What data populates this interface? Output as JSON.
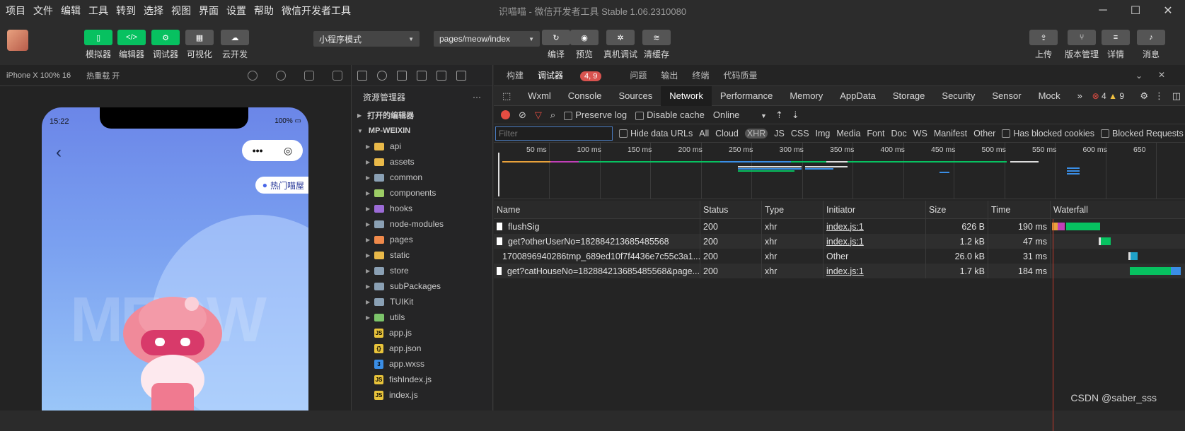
{
  "menu": [
    "项目",
    "文件",
    "编辑",
    "工具",
    "转到",
    "选择",
    "视图",
    "界面",
    "设置",
    "帮助",
    "微信开发者工具"
  ],
  "window_title": "识喵喵 - 微信开发者工具 Stable 1.06.2310080",
  "toolbar": {
    "left_buttons": [
      "模拟器",
      "编辑器",
      "调试器",
      "可视化",
      "云开发"
    ],
    "mode": "小程序模式",
    "page_path": "pages/meow/index",
    "mid_buttons": [
      "编译",
      "预览",
      "真机调试",
      "清缓存"
    ],
    "right_buttons": [
      "上传",
      "版本管理",
      "详情",
      "消息"
    ]
  },
  "simulator": {
    "device": "iPhone X 100% 16",
    "hot_reload": "热重载 开",
    "time": "15:22",
    "battery": "100%",
    "hot_button": "热门喵屋",
    "watermark_text": "MEOW"
  },
  "explorer": {
    "title": "资源管理器",
    "open_editors": "打开的编辑器",
    "project": "MP-WEIXIN",
    "folders": [
      {
        "name": "api",
        "color": "#e9b949"
      },
      {
        "name": "assets",
        "color": "#e9b949"
      },
      {
        "name": "common",
        "color": "#8aa0b4"
      },
      {
        "name": "components",
        "color": "#9ccc65"
      },
      {
        "name": "hooks",
        "color": "#9c6bd6"
      },
      {
        "name": "node-modules",
        "color": "#8aa0b4"
      },
      {
        "name": "pages",
        "color": "#f08a4b"
      },
      {
        "name": "static",
        "color": "#e9b949"
      },
      {
        "name": "store",
        "color": "#8aa0b4"
      },
      {
        "name": "subPackages",
        "color": "#8aa0b4"
      },
      {
        "name": "TUIKit",
        "color": "#8aa0b4"
      },
      {
        "name": "utils",
        "color": "#7cc46a"
      }
    ],
    "files": [
      {
        "name": "app.js",
        "icon": "JS",
        "color": "#e9c43b"
      },
      {
        "name": "app.json",
        "icon": "{}",
        "color": "#e9c43b"
      },
      {
        "name": "app.wxss",
        "icon": "3",
        "color": "#3a8ee6"
      },
      {
        "name": "fishIndex.js",
        "icon": "JS",
        "color": "#e9c43b"
      },
      {
        "name": "index.js",
        "icon": "JS",
        "color": "#e9c43b"
      }
    ]
  },
  "devtools": {
    "tabs": [
      "构建",
      "调试器",
      "问题",
      "输出",
      "终端",
      "代码质量"
    ],
    "debugger_badge": "4, 9",
    "console_tabs": [
      "Wxml",
      "Console",
      "Sources",
      "Network",
      "Performance",
      "Memory",
      "AppData",
      "Storage",
      "Security",
      "Sensor",
      "Mock"
    ],
    "errors": "4",
    "warnings": "9",
    "preserve_log": "Preserve log",
    "disable_cache": "Disable cache",
    "throttle": "Online",
    "filter_placeholder": "Filter",
    "hide_data_urls": "Hide data URLs",
    "filter_types": [
      "All",
      "Cloud",
      "XHR",
      "JS",
      "CSS",
      "Img",
      "Media",
      "Font",
      "Doc",
      "WS",
      "Manifest",
      "Other"
    ],
    "has_blocked": "Has blocked cookies",
    "blocked_requests": "Blocked Requests",
    "ticks": [
      "50 ms",
      "100 ms",
      "150 ms",
      "200 ms",
      "250 ms",
      "300 ms",
      "350 ms",
      "400 ms",
      "450 ms",
      "500 ms",
      "550 ms",
      "600 ms",
      "650"
    ],
    "columns": [
      "Name",
      "Status",
      "Type",
      "Initiator",
      "Size",
      "Time",
      "Waterfall"
    ],
    "rows": [
      {
        "name": "flushSig",
        "status": "200",
        "type": "xhr",
        "initiator": "index.js:1",
        "size": "626 B",
        "time": "190 ms"
      },
      {
        "name": "get?otherUserNo=182884213685485568",
        "status": "200",
        "type": "xhr",
        "initiator": "index.js:1",
        "size": "1.2 kB",
        "time": "47 ms"
      },
      {
        "name": "1700896940286tmp_689ed10f7f4436e7c55c3a1...",
        "status": "200",
        "type": "xhr",
        "initiator": "Other",
        "size": "26.0 kB",
        "time": "31 ms"
      },
      {
        "name": "get?catHouseNo=182884213685485568&page...",
        "status": "200",
        "type": "xhr",
        "initiator": "index.js:1",
        "size": "1.7 kB",
        "time": "184 ms"
      }
    ]
  },
  "watermark": "CSDN @saber_sss"
}
